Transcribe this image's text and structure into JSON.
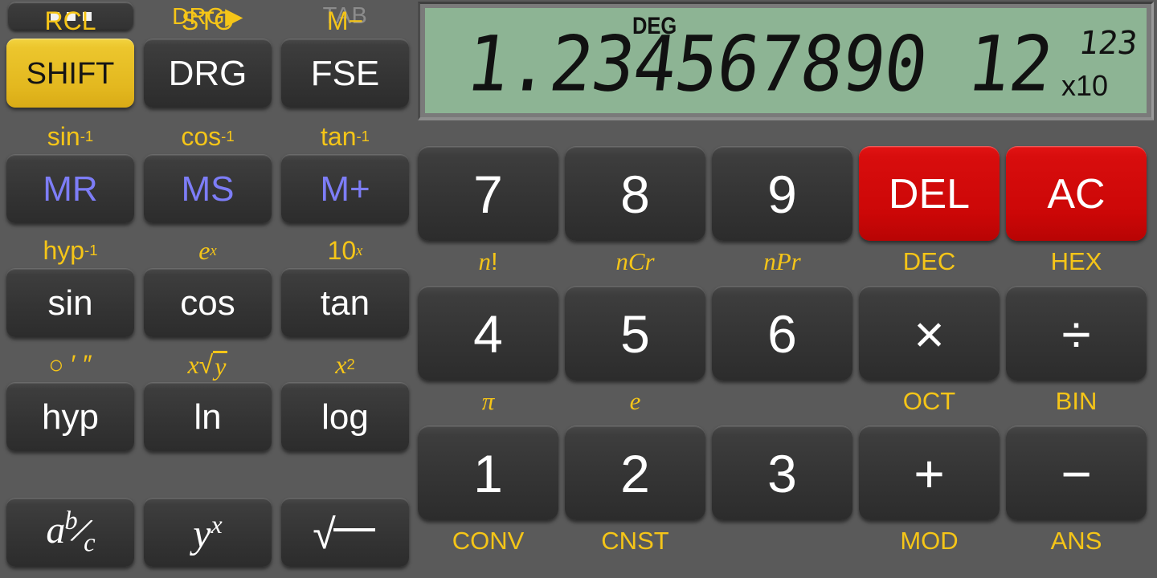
{
  "app": {
    "name": "scientific-calculator",
    "mode": "DEG"
  },
  "colors": {
    "background": "#5a5a5a",
    "key_face": "#3a3a3a",
    "shift_yellow": "#e8c02a",
    "secondary_label": "#f5c518",
    "memory_text": "#7d7df7",
    "danger_red": "#d00a0a",
    "lcd_green": "#8db494",
    "lcd_text": "#111111",
    "disabled_label": "#8c8c8c"
  },
  "display": {
    "mode_indicator": "DEG",
    "mantissa": "1.234567890 12",
    "exponent": "123",
    "exponent_prefix": "x10"
  },
  "left_panel": {
    "menu_button": {
      "name": "overflow-menu",
      "dots": 3
    },
    "top_labels": [
      {
        "text": "DRG▶",
        "state": "active"
      },
      {
        "text": "TAB",
        "state": "disabled"
      }
    ],
    "rows": [
      {
        "keys": [
          {
            "label": "SHIFT",
            "second": "RCL",
            "style": "shift"
          },
          {
            "label": "DRG",
            "second": "STO",
            "style": "normal"
          },
          {
            "label": "FSE",
            "second": "M−",
            "style": "normal"
          }
        ]
      },
      {
        "keys": [
          {
            "label": "MR",
            "second": "sin-1",
            "second_html": "sin<sup>-1</sup>",
            "style": "mem"
          },
          {
            "label": "MS",
            "second": "cos-1",
            "second_html": "cos<sup>-1</sup>",
            "style": "mem"
          },
          {
            "label": "M+",
            "second": "tan-1",
            "second_html": "tan<sup>-1</sup>",
            "style": "mem"
          }
        ]
      },
      {
        "keys": [
          {
            "label": "sin",
            "second": "hyp-1",
            "second_html": "hyp<sup>-1</sup>",
            "style": "normal"
          },
          {
            "label": "cos",
            "second": "e^x",
            "second_html": "<i class=\"it\">e</i><sup><i class=\"it\">x</i></sup>",
            "style": "normal"
          },
          {
            "label": "tan",
            "second": "10^x",
            "second_html": "10<sup><i class=\"it\">x</i></sup>",
            "style": "normal"
          }
        ]
      },
      {
        "keys": [
          {
            "label": "hyp",
            "second": "deg-min-sec",
            "second_html": "○ ′ ″",
            "style": "normal"
          },
          {
            "label": "ln",
            "second": "x-root-y",
            "second_html": "<i class=\"it\">x</i>√<span style=\"border-top:3px solid #f5c518;padding:0 2px\"><i class=\"it\">y</i></span>",
            "style": "normal"
          },
          {
            "label": "log",
            "second": "x^2",
            "second_html": "<i class=\"it\">x</i><sup>2</sup>",
            "style": "normal"
          }
        ]
      },
      {
        "keys": [
          {
            "label": "a b/c",
            "label_html": "<i>a</i><sup><i>b</i></sup>⁄<sub><i>c</i></sub>",
            "second": "",
            "style": "normal"
          },
          {
            "label": "y^x",
            "label_html": "<i>y</i><sup><i>x</i></sup>",
            "second": "",
            "style": "normal"
          },
          {
            "label": "sqrt",
            "label_html": "√̅̅",
            "second": "",
            "style": "normal"
          }
        ]
      }
    ]
  },
  "right_panel": {
    "rows": [
      {
        "keys": [
          {
            "label": "7",
            "sub": "n!",
            "sub_html": "<i class=\"it\">n</i>!",
            "style": "normal"
          },
          {
            "label": "8",
            "sub": "nCr",
            "sub_html": "<i class=\"it\">nCr</i>",
            "style": "normal"
          },
          {
            "label": "9",
            "sub": "nPr",
            "sub_html": "<i class=\"it\">nPr</i>",
            "style": "normal"
          },
          {
            "label": "DEL",
            "sub": "DEC",
            "style": "red"
          },
          {
            "label": "AC",
            "sub": "HEX",
            "style": "red"
          }
        ]
      },
      {
        "keys": [
          {
            "label": "4",
            "sub": "pi",
            "sub_html": "<i class=\"it\">π</i>",
            "style": "normal"
          },
          {
            "label": "5",
            "sub": "e",
            "sub_html": "<i class=\"it\">e</i>",
            "style": "normal"
          },
          {
            "label": "6",
            "sub": "",
            "style": "normal"
          },
          {
            "label": "×",
            "sub": "OCT",
            "style": "normal"
          },
          {
            "label": "÷",
            "sub": "BIN",
            "style": "normal"
          }
        ]
      },
      {
        "keys": [
          {
            "label": "1",
            "sub": "CONV",
            "style": "normal"
          },
          {
            "label": "2",
            "sub": "CNST",
            "style": "normal"
          },
          {
            "label": "3",
            "sub": "",
            "style": "normal"
          },
          {
            "label": "+",
            "sub": "MOD",
            "style": "normal"
          },
          {
            "label": "−",
            "sub": "ANS",
            "style": "normal"
          }
        ]
      }
    ]
  }
}
